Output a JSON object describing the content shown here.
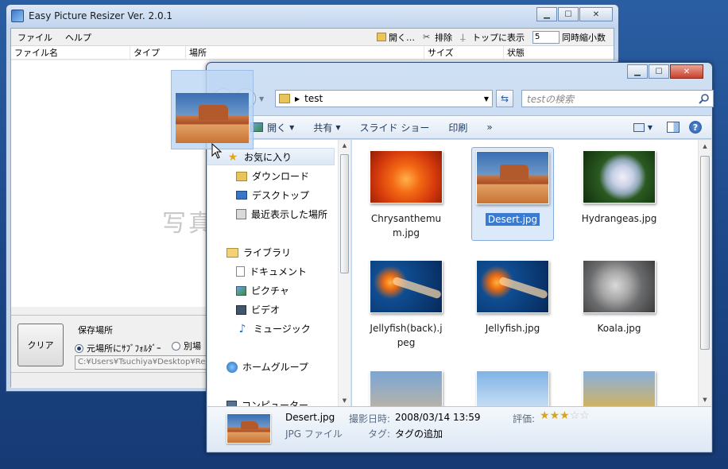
{
  "resizer": {
    "title": "Easy Picture Resizer Ver. 2.0.1",
    "menu": [
      "ファイル",
      "ヘルプ"
    ],
    "toolbar": {
      "open": "開く…",
      "exclude": "排除",
      "topmost": "トップに表示",
      "count_value": "5",
      "count_label": "同時縮小数"
    },
    "columns": [
      "ファイル名",
      "タイプ",
      "場所",
      "サイズ",
      "状態"
    ],
    "watermark": "写真",
    "clear_button": "クリア",
    "save_group_label": "保存場所",
    "radio_same": "元場所にｻﾌﾞﾌｫﾙﾀﾞｰ",
    "radio_other": "別場",
    "path_value": "C:¥Users¥Tsuchiya¥Desktop¥Re"
  },
  "explorer": {
    "address": "test",
    "search_placeholder": "testの検索",
    "toolbar": {
      "open": "開く",
      "share": "共有",
      "slideshow": "スライド ショー",
      "print": "印刷",
      "more": "»"
    },
    "nav": {
      "favorites": "お気に入り",
      "downloads": "ダウンロード",
      "desktop": "デスクトップ",
      "recent": "最近表示した場所",
      "libraries": "ライブラリ",
      "documents": "ドキュメント",
      "pictures": "ピクチャ",
      "videos": "ビデオ",
      "music": "ミュージック",
      "homegroup": "ホームグループ",
      "computer": "コンピューター"
    },
    "files": [
      {
        "name": "Chrysanthemum.jpg",
        "art": "chrys"
      },
      {
        "name": "Desert.jpg",
        "art": "desert",
        "selected": true
      },
      {
        "name": "Hydrangeas.jpg",
        "art": "hydra"
      },
      {
        "name": "Jellyfish(back).jpeg",
        "art": "jelly"
      },
      {
        "name": "Jellyfish.jpg",
        "art": "jelly"
      },
      {
        "name": "Koala.jpg",
        "art": "koala"
      }
    ],
    "details": {
      "filename": "Desert.jpg",
      "date_label": "撮影日時:",
      "date_value": "2008/03/14 13:59",
      "rating_label": "評価:",
      "rating": 3,
      "rating_max": 5,
      "type": "JPG ファイル",
      "tags_label": "タグ:",
      "tags_value": "タグの追加"
    }
  }
}
